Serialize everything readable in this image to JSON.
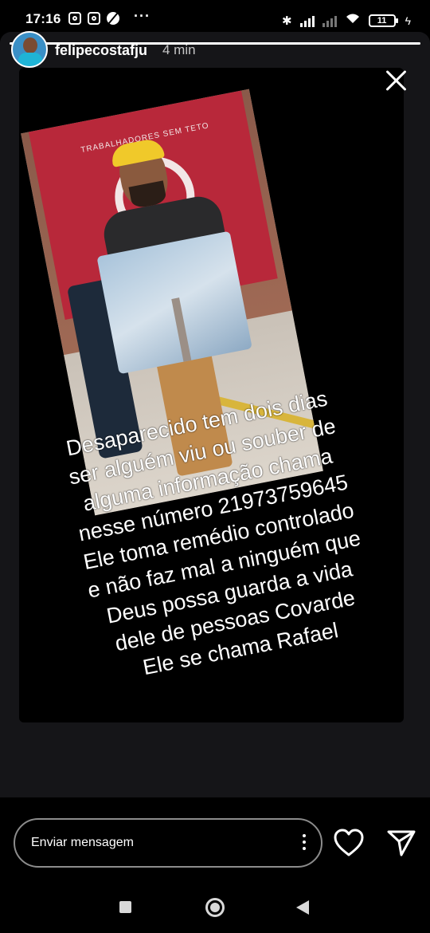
{
  "status_bar": {
    "time": "17:16",
    "battery": "11"
  },
  "story": {
    "username": "felipecostafju",
    "time_ago": "4 min",
    "banner_text": "TRABALHADORES SEM TETO",
    "caption_lines": [
      "Desaparecido tem dois dias",
      "ser alguém viu ou souber de",
      "alguma informação chama",
      "nesse número 21973759645",
      "Ele toma remédio controlado",
      "e não faz mal a ninguém que",
      "Deus possa guarda a vida",
      "dele de pessoas Covarde",
      "Ele se chama Rafael"
    ],
    "progress": 1.0
  },
  "reply_bar": {
    "placeholder": "Enviar mensagem"
  },
  "icons": {
    "close": "close-icon",
    "heart": "heart-icon",
    "send": "send-icon",
    "more": "more-vertical-icon"
  }
}
